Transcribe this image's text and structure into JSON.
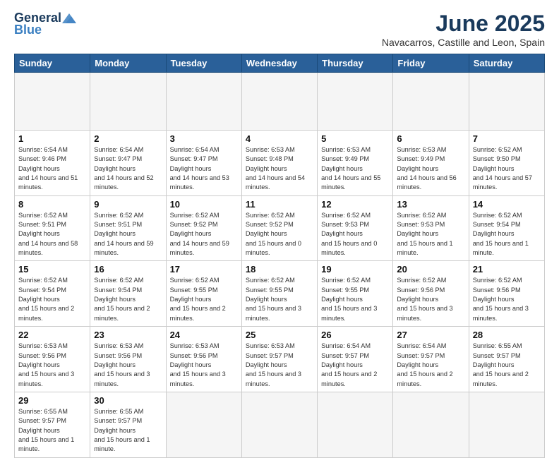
{
  "header": {
    "logo_general": "General",
    "logo_blue": "Blue",
    "title": "June 2025",
    "subtitle": "Navacarros, Castille and Leon, Spain"
  },
  "calendar": {
    "days_of_week": [
      "Sunday",
      "Monday",
      "Tuesday",
      "Wednesday",
      "Thursday",
      "Friday",
      "Saturday"
    ],
    "weeks": [
      [
        {
          "day": "",
          "empty": true
        },
        {
          "day": "",
          "empty": true
        },
        {
          "day": "",
          "empty": true
        },
        {
          "day": "",
          "empty": true
        },
        {
          "day": "",
          "empty": true
        },
        {
          "day": "",
          "empty": true
        },
        {
          "day": "",
          "empty": true
        }
      ],
      [
        {
          "day": "1",
          "rise": "6:54 AM",
          "set": "9:46 PM",
          "daylight": "14 hours and 51 minutes."
        },
        {
          "day": "2",
          "rise": "6:54 AM",
          "set": "9:47 PM",
          "daylight": "14 hours and 52 minutes."
        },
        {
          "day": "3",
          "rise": "6:54 AM",
          "set": "9:47 PM",
          "daylight": "14 hours and 53 minutes."
        },
        {
          "day": "4",
          "rise": "6:53 AM",
          "set": "9:48 PM",
          "daylight": "14 hours and 54 minutes."
        },
        {
          "day": "5",
          "rise": "6:53 AM",
          "set": "9:49 PM",
          "daylight": "14 hours and 55 minutes."
        },
        {
          "day": "6",
          "rise": "6:53 AM",
          "set": "9:49 PM",
          "daylight": "14 hours and 56 minutes."
        },
        {
          "day": "7",
          "rise": "6:52 AM",
          "set": "9:50 PM",
          "daylight": "14 hours and 57 minutes."
        }
      ],
      [
        {
          "day": "8",
          "rise": "6:52 AM",
          "set": "9:51 PM",
          "daylight": "14 hours and 58 minutes."
        },
        {
          "day": "9",
          "rise": "6:52 AM",
          "set": "9:51 PM",
          "daylight": "14 hours and 59 minutes."
        },
        {
          "day": "10",
          "rise": "6:52 AM",
          "set": "9:52 PM",
          "daylight": "14 hours and 59 minutes."
        },
        {
          "day": "11",
          "rise": "6:52 AM",
          "set": "9:52 PM",
          "daylight": "15 hours and 0 minutes."
        },
        {
          "day": "12",
          "rise": "6:52 AM",
          "set": "9:53 PM",
          "daylight": "15 hours and 0 minutes."
        },
        {
          "day": "13",
          "rise": "6:52 AM",
          "set": "9:53 PM",
          "daylight": "15 hours and 1 minute."
        },
        {
          "day": "14",
          "rise": "6:52 AM",
          "set": "9:54 PM",
          "daylight": "15 hours and 1 minute."
        }
      ],
      [
        {
          "day": "15",
          "rise": "6:52 AM",
          "set": "9:54 PM",
          "daylight": "15 hours and 2 minutes."
        },
        {
          "day": "16",
          "rise": "6:52 AM",
          "set": "9:54 PM",
          "daylight": "15 hours and 2 minutes."
        },
        {
          "day": "17",
          "rise": "6:52 AM",
          "set": "9:55 PM",
          "daylight": "15 hours and 2 minutes."
        },
        {
          "day": "18",
          "rise": "6:52 AM",
          "set": "9:55 PM",
          "daylight": "15 hours and 3 minutes."
        },
        {
          "day": "19",
          "rise": "6:52 AM",
          "set": "9:55 PM",
          "daylight": "15 hours and 3 minutes."
        },
        {
          "day": "20",
          "rise": "6:52 AM",
          "set": "9:56 PM",
          "daylight": "15 hours and 3 minutes."
        },
        {
          "day": "21",
          "rise": "6:52 AM",
          "set": "9:56 PM",
          "daylight": "15 hours and 3 minutes."
        }
      ],
      [
        {
          "day": "22",
          "rise": "6:53 AM",
          "set": "9:56 PM",
          "daylight": "15 hours and 3 minutes."
        },
        {
          "day": "23",
          "rise": "6:53 AM",
          "set": "9:56 PM",
          "daylight": "15 hours and 3 minutes."
        },
        {
          "day": "24",
          "rise": "6:53 AM",
          "set": "9:56 PM",
          "daylight": "15 hours and 3 minutes."
        },
        {
          "day": "25",
          "rise": "6:53 AM",
          "set": "9:57 PM",
          "daylight": "15 hours and 3 minutes."
        },
        {
          "day": "26",
          "rise": "6:54 AM",
          "set": "9:57 PM",
          "daylight": "15 hours and 2 minutes."
        },
        {
          "day": "27",
          "rise": "6:54 AM",
          "set": "9:57 PM",
          "daylight": "15 hours and 2 minutes."
        },
        {
          "day": "28",
          "rise": "6:55 AM",
          "set": "9:57 PM",
          "daylight": "15 hours and 2 minutes."
        }
      ],
      [
        {
          "day": "29",
          "rise": "6:55 AM",
          "set": "9:57 PM",
          "daylight": "15 hours and 1 minute."
        },
        {
          "day": "30",
          "rise": "6:55 AM",
          "set": "9:57 PM",
          "daylight": "15 hours and 1 minute."
        },
        {
          "day": "",
          "empty": true
        },
        {
          "day": "",
          "empty": true
        },
        {
          "day": "",
          "empty": true
        },
        {
          "day": "",
          "empty": true
        },
        {
          "day": "",
          "empty": true
        }
      ]
    ]
  }
}
